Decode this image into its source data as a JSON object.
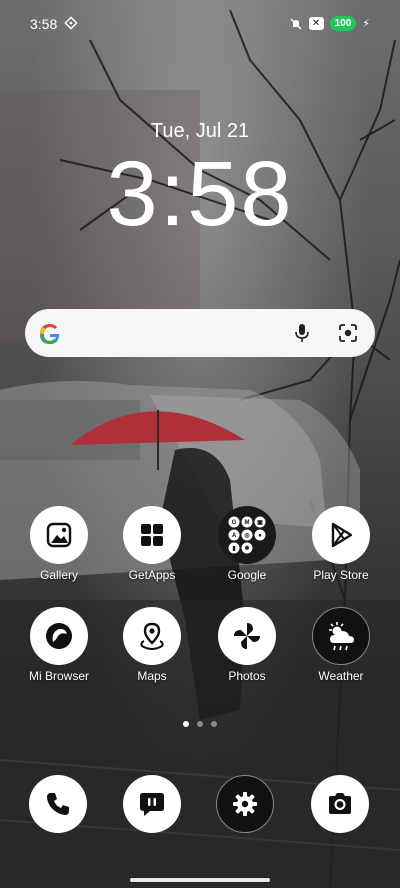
{
  "status_bar": {
    "time": "3:58",
    "battery": "100"
  },
  "lockscreen": {
    "date": "Tue, Jul 21",
    "clock": "3:58"
  },
  "search": {
    "brand_letter": "G"
  },
  "apps_row1": [
    {
      "label": "Gallery",
      "icon": "gallery-icon"
    },
    {
      "label": "GetApps",
      "icon": "getapps-icon"
    },
    {
      "label": "Google",
      "icon": "google-folder-icon"
    },
    {
      "label": "Play Store",
      "icon": "play-store-icon"
    }
  ],
  "apps_row2": [
    {
      "label": "Mi Browser",
      "icon": "browser-icon"
    },
    {
      "label": "Maps",
      "icon": "maps-icon"
    },
    {
      "label": "Photos",
      "icon": "photos-icon"
    },
    {
      "label": "Weather",
      "icon": "weather-icon"
    }
  ],
  "dock": [
    {
      "icon": "phone-icon"
    },
    {
      "icon": "messages-icon"
    },
    {
      "icon": "settings-icon"
    },
    {
      "icon": "camera-icon"
    }
  ],
  "page_indicator": {
    "pages": 3,
    "active_index": 0
  },
  "colors": {
    "battery": "#25c55c",
    "icon_bg": "#ffffff",
    "dark_icon_bg": "#111111"
  }
}
